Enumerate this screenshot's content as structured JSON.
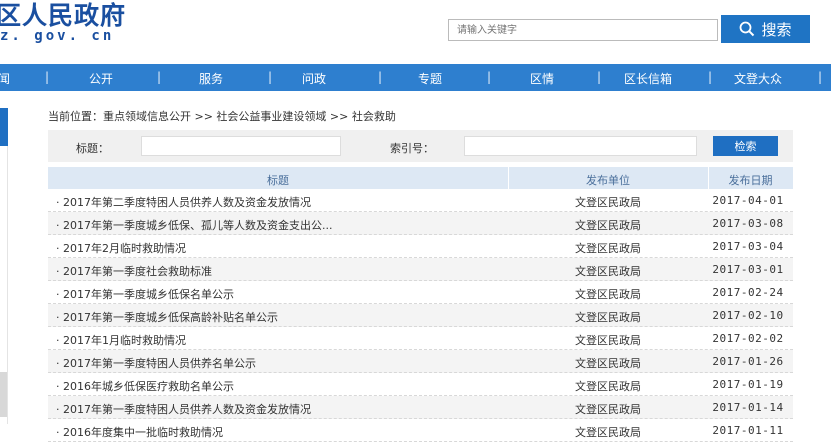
{
  "header": {
    "site_title": "区人民政府",
    "site_domain": "z. gov. cn",
    "search_placeholder": "请输入关键字",
    "search_button": "搜索"
  },
  "nav": {
    "items": [
      "闻",
      "公开",
      "服务",
      "问政",
      "专题",
      "区情",
      "区长信箱",
      "文登大众"
    ]
  },
  "breadcrumb": "当前位置：重点领域信息公开 >> 社会公益事业建设领域 >> 社会救助",
  "filter": {
    "title_label": "标题：",
    "index_label": "索引号：",
    "search_button": "检索"
  },
  "table": {
    "headers": [
      "标题",
      "发布单位",
      "发布日期"
    ],
    "rows": [
      {
        "title": "· 2017年第二季度特困人员供养人数及资金发放情况",
        "unit": "文登区民政局",
        "date": "2017-04-01"
      },
      {
        "title": "· 2017年第一季度城乡低保、孤儿等人数及资金支出公...",
        "unit": "文登区民政局",
        "date": "2017-03-08"
      },
      {
        "title": "· 2017年2月临时救助情况",
        "unit": "文登区民政局",
        "date": "2017-03-04"
      },
      {
        "title": "· 2017年第一季度社会救助标准",
        "unit": "文登区民政局",
        "date": "2017-03-01"
      },
      {
        "title": "· 2017年第一季度城乡低保名单公示",
        "unit": "文登区民政局",
        "date": "2017-02-24"
      },
      {
        "title": "· 2017年第一季度城乡低保高龄补贴名单公示",
        "unit": "文登区民政局",
        "date": "2017-02-10"
      },
      {
        "title": "· 2017年1月临时救助情况",
        "unit": "文登区民政局",
        "date": "2017-02-02"
      },
      {
        "title": "· 2017年第一季度特困人员供养名单公示",
        "unit": "文登区民政局",
        "date": "2017-01-26"
      },
      {
        "title": "· 2016年城乡低保医疗救助名单公示",
        "unit": "文登区民政局",
        "date": "2017-01-19"
      },
      {
        "title": "· 2017年第一季度特困人员供养人数及资金发放情况",
        "unit": "文登区民政局",
        "date": "2017-01-14"
      },
      {
        "title": "· 2016年度集中一批临时救助情况",
        "unit": "文登区民政局",
        "date": "2017-01-11"
      }
    ]
  },
  "colors": {
    "brand_blue": "#1f74c4",
    "nav_blue": "#2e7fcf",
    "table_header_bg": "#dde8f4"
  },
  "icons": {
    "search_button_icon": "search-icon"
  }
}
